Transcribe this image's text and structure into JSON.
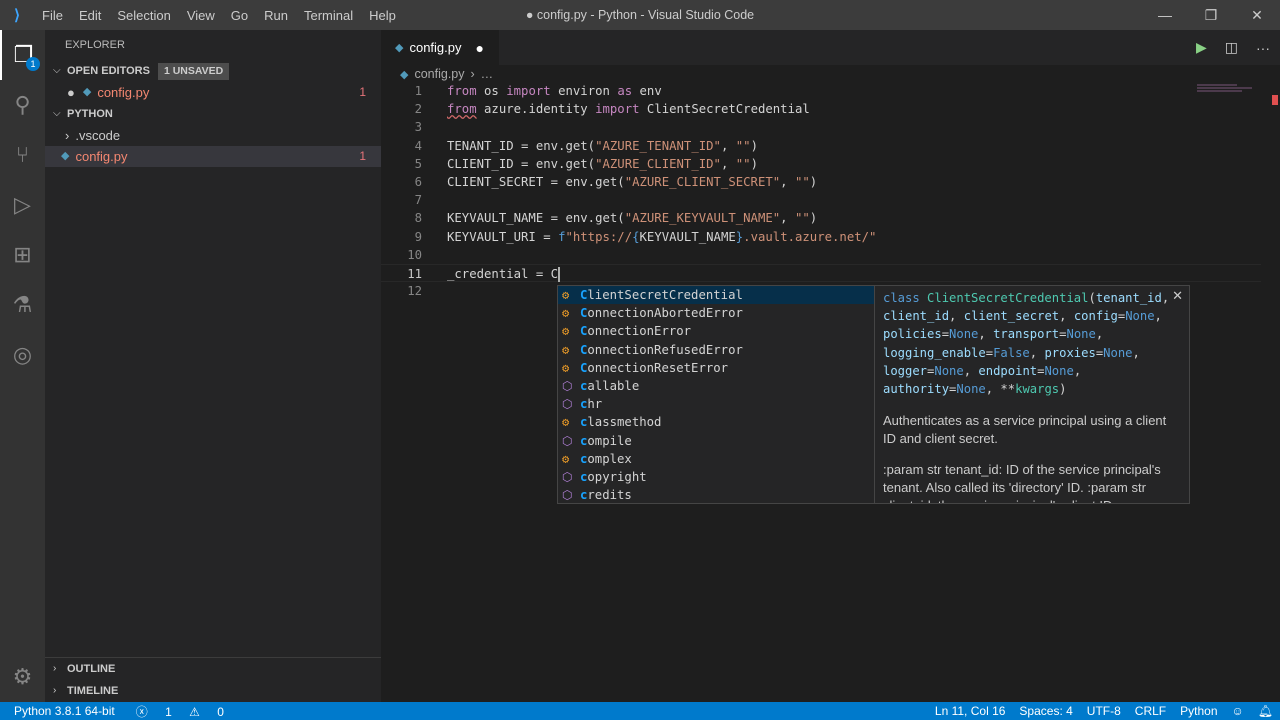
{
  "window": {
    "title": "● config.py - Python - Visual Studio Code",
    "logo": "VS Code"
  },
  "menu": [
    "File",
    "Edit",
    "Selection",
    "View",
    "Go",
    "Run",
    "Terminal",
    "Help"
  ],
  "activity": {
    "explorer_badge": "1"
  },
  "sidebar": {
    "title": "EXPLORER",
    "open_editors": {
      "label": "OPEN EDITORS",
      "badge": "1 UNSAVED",
      "items": [
        {
          "name": "config.py",
          "problems": "1"
        }
      ]
    },
    "folder": {
      "label": "PYTHON",
      "items": [
        {
          "name": ".vscode",
          "type": "folder"
        },
        {
          "name": "config.py",
          "problems": "1"
        }
      ]
    },
    "outline": "OUTLINE",
    "timeline": "TIMELINE"
  },
  "tab": {
    "label": "config.py",
    "dirty": "●"
  },
  "breadcrumb": {
    "file": "config.py",
    "rest": "…"
  },
  "code": [
    [
      [
        "k",
        "from"
      ],
      [
        "v",
        " os "
      ],
      [
        "k",
        "import"
      ],
      [
        "v",
        " environ "
      ],
      [
        "k",
        "as"
      ],
      [
        "v",
        " env"
      ]
    ],
    [
      [
        "k sq",
        "from"
      ],
      [
        "v",
        " azure.identity "
      ],
      [
        "k",
        "import"
      ],
      [
        "v",
        " ClientSecretCredential"
      ]
    ],
    [],
    [
      [
        "v",
        "TENANT_ID = env.get("
      ],
      [
        "s",
        "\"AZURE_TENANT_ID\""
      ],
      [
        "v",
        ", "
      ],
      [
        "s",
        "\"\""
      ],
      [
        "v",
        ")"
      ]
    ],
    [
      [
        "v",
        "CLIENT_ID = env.get("
      ],
      [
        "s",
        "\"AZURE_CLIENT_ID\""
      ],
      [
        "v",
        ", "
      ],
      [
        "s",
        "\"\""
      ],
      [
        "v",
        ")"
      ]
    ],
    [
      [
        "v",
        "CLIENT_SECRET = env.get("
      ],
      [
        "s",
        "\"AZURE_CLIENT_SECRET\""
      ],
      [
        "v",
        ", "
      ],
      [
        "s",
        "\"\""
      ],
      [
        "v",
        ")"
      ]
    ],
    [],
    [
      [
        "v",
        "KEYVAULT_NAME = env.get("
      ],
      [
        "s",
        "\"AZURE_KEYVAULT_NAME\""
      ],
      [
        "v",
        ", "
      ],
      [
        "s",
        "\"\""
      ],
      [
        "v",
        ")"
      ]
    ],
    [
      [
        "v",
        "KEYVAULT_URI = "
      ],
      [
        "b",
        "f"
      ],
      [
        "s",
        "\"https://"
      ],
      [
        "b",
        "{"
      ],
      [
        "v",
        "KEYVAULT_NAME"
      ],
      [
        "b",
        "}"
      ],
      [
        "s",
        ".vault.azure.net/\""
      ]
    ],
    [],
    [
      [
        "v",
        "_credential = C"
      ]
    ],
    []
  ],
  "cursor_line": 11,
  "suggestions": [
    {
      "label": "ClientSecretCredential",
      "kind": "class"
    },
    {
      "label": "ConnectionAbortedError",
      "kind": "class"
    },
    {
      "label": "ConnectionError",
      "kind": "class"
    },
    {
      "label": "ConnectionRefusedError",
      "kind": "class"
    },
    {
      "label": "ConnectionResetError",
      "kind": "class"
    },
    {
      "label": "callable",
      "kind": "function"
    },
    {
      "label": "chr",
      "kind": "function"
    },
    {
      "label": "classmethod",
      "kind": "class"
    },
    {
      "label": "compile",
      "kind": "function"
    },
    {
      "label": "complex",
      "kind": "class"
    },
    {
      "label": "copyright",
      "kind": "function"
    },
    {
      "label": "credits",
      "kind": "function"
    }
  ],
  "details": {
    "signature": [
      [
        "n",
        "class "
      ],
      [
        "c",
        "ClientSecretCredential"
      ],
      [
        "v",
        "("
      ],
      [
        "p",
        "tenant_id"
      ],
      [
        "v",
        ", "
      ],
      [
        "p",
        "client_id"
      ],
      [
        "v",
        ", "
      ],
      [
        "p",
        "client_secret"
      ],
      [
        "v",
        ", "
      ],
      [
        "p",
        "config"
      ],
      [
        "v",
        "="
      ],
      [
        "n",
        "None"
      ],
      [
        "v",
        ", "
      ],
      [
        "p",
        "policies"
      ],
      [
        "v",
        "="
      ],
      [
        "n",
        "None"
      ],
      [
        "v",
        ", "
      ],
      [
        "p",
        "transport"
      ],
      [
        "v",
        "="
      ],
      [
        "n",
        "None"
      ],
      [
        "v",
        ", "
      ],
      [
        "p",
        "logging_enable"
      ],
      [
        "v",
        "="
      ],
      [
        "n",
        "False"
      ],
      [
        "v",
        ", "
      ],
      [
        "p",
        "proxies"
      ],
      [
        "v",
        "="
      ],
      [
        "n",
        "None"
      ],
      [
        "v",
        ", "
      ],
      [
        "p",
        "logger"
      ],
      [
        "v",
        "="
      ],
      [
        "n",
        "None"
      ],
      [
        "v",
        ", "
      ],
      [
        "p",
        "endpoint"
      ],
      [
        "v",
        "="
      ],
      [
        "n",
        "None"
      ],
      [
        "v",
        ", "
      ],
      [
        "p",
        "authority"
      ],
      [
        "v",
        "="
      ],
      [
        "n",
        "None"
      ],
      [
        "v",
        ", **"
      ],
      [
        "c",
        "kwargs"
      ],
      [
        "v",
        ")"
      ]
    ],
    "doc1": "Authenticates as a service principal using a client ID and client secret.",
    "doc2": ":param str tenant_id: ID of the service principal's tenant. Also called its 'directory' ID. :param str client_id: the service principal's client ID"
  },
  "status": {
    "interpreter": "Python 3.8.1 64-bit",
    "errors": "1",
    "warnings": "0",
    "position": "Ln 11, Col 16",
    "spaces": "Spaces: 4",
    "encoding": "UTF-8",
    "eol": "CRLF",
    "language": "Python"
  }
}
